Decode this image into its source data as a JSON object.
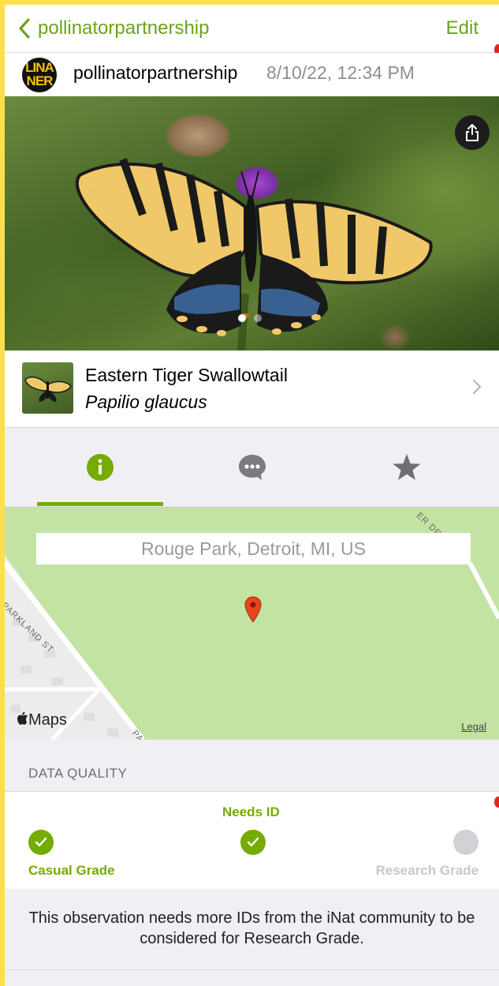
{
  "colors": {
    "accent": "#74ac00",
    "link": "#6ba31b",
    "grey_text": "#8e8e93",
    "page_bg": "#efeff4",
    "map_bg": "#c3e3a3",
    "pin": "#e8451e"
  },
  "navbar": {
    "back_label": "pollinatorpartnership",
    "edit_label": "Edit"
  },
  "observer": {
    "username": "pollinatorpartnership",
    "datetime": "8/10/22, 12:34 PM",
    "avatar_logo_lines": [
      "LINA",
      "NER"
    ]
  },
  "photo": {
    "page_count": 2,
    "current_page": 1,
    "share_icon": "share-icon"
  },
  "taxon": {
    "common_name": "Eastern Tiger Swallowtail",
    "scientific_name": "Papilio glaucus"
  },
  "tabs": [
    {
      "name": "info",
      "icon": "info-icon",
      "selected": true
    },
    {
      "name": "activity",
      "icon": "chat-bubble-icon",
      "selected": false
    },
    {
      "name": "favorites",
      "icon": "star-icon",
      "selected": false
    }
  ],
  "map": {
    "location": "Rouge Park, Detroit, MI, US",
    "street_1": "PARKLAND ST",
    "street_2": "ER DR",
    "street_3": "PA",
    "maps_label": "Maps",
    "legal_label": "Legal"
  },
  "data_quality": {
    "header": "DATA QUALITY",
    "stages": [
      {
        "label": "Casual Grade",
        "reached": true
      },
      {
        "label": "Needs ID",
        "reached": true,
        "current": true
      },
      {
        "label": "Research Grade",
        "reached": false
      }
    ],
    "note": "This observation needs more IDs from the iNat community to be considered for Research Grade."
  }
}
